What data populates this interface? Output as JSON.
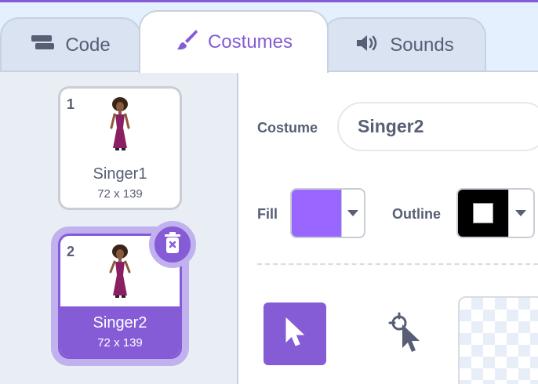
{
  "tabs": {
    "code": {
      "label": "Code",
      "icon": "code-blocks-icon"
    },
    "costumes": {
      "label": "Costumes",
      "icon": "paintbrush-icon"
    },
    "sounds": {
      "label": "Sounds",
      "icon": "speaker-icon"
    }
  },
  "costumes": [
    {
      "number": "1",
      "name": "Singer1",
      "size": "72 x 139",
      "selected": false
    },
    {
      "number": "2",
      "name": "Singer2",
      "size": "72 x 139",
      "selected": true
    }
  ],
  "editor": {
    "costume_label": "Costume",
    "costume_name": "Singer2",
    "fill_label": "Fill",
    "fill_color": "#9966ff",
    "outline_label": "Outline",
    "outline_color": "#000000"
  },
  "tools": [
    {
      "name": "select",
      "icon": "arrow-cursor-icon",
      "active": true
    },
    {
      "name": "reshape",
      "icon": "reshape-icon",
      "active": false
    }
  ],
  "colors": {
    "accent": "#855cd6",
    "accent_light": "#c2b1ef",
    "pane_bg": "#e9eef5"
  }
}
